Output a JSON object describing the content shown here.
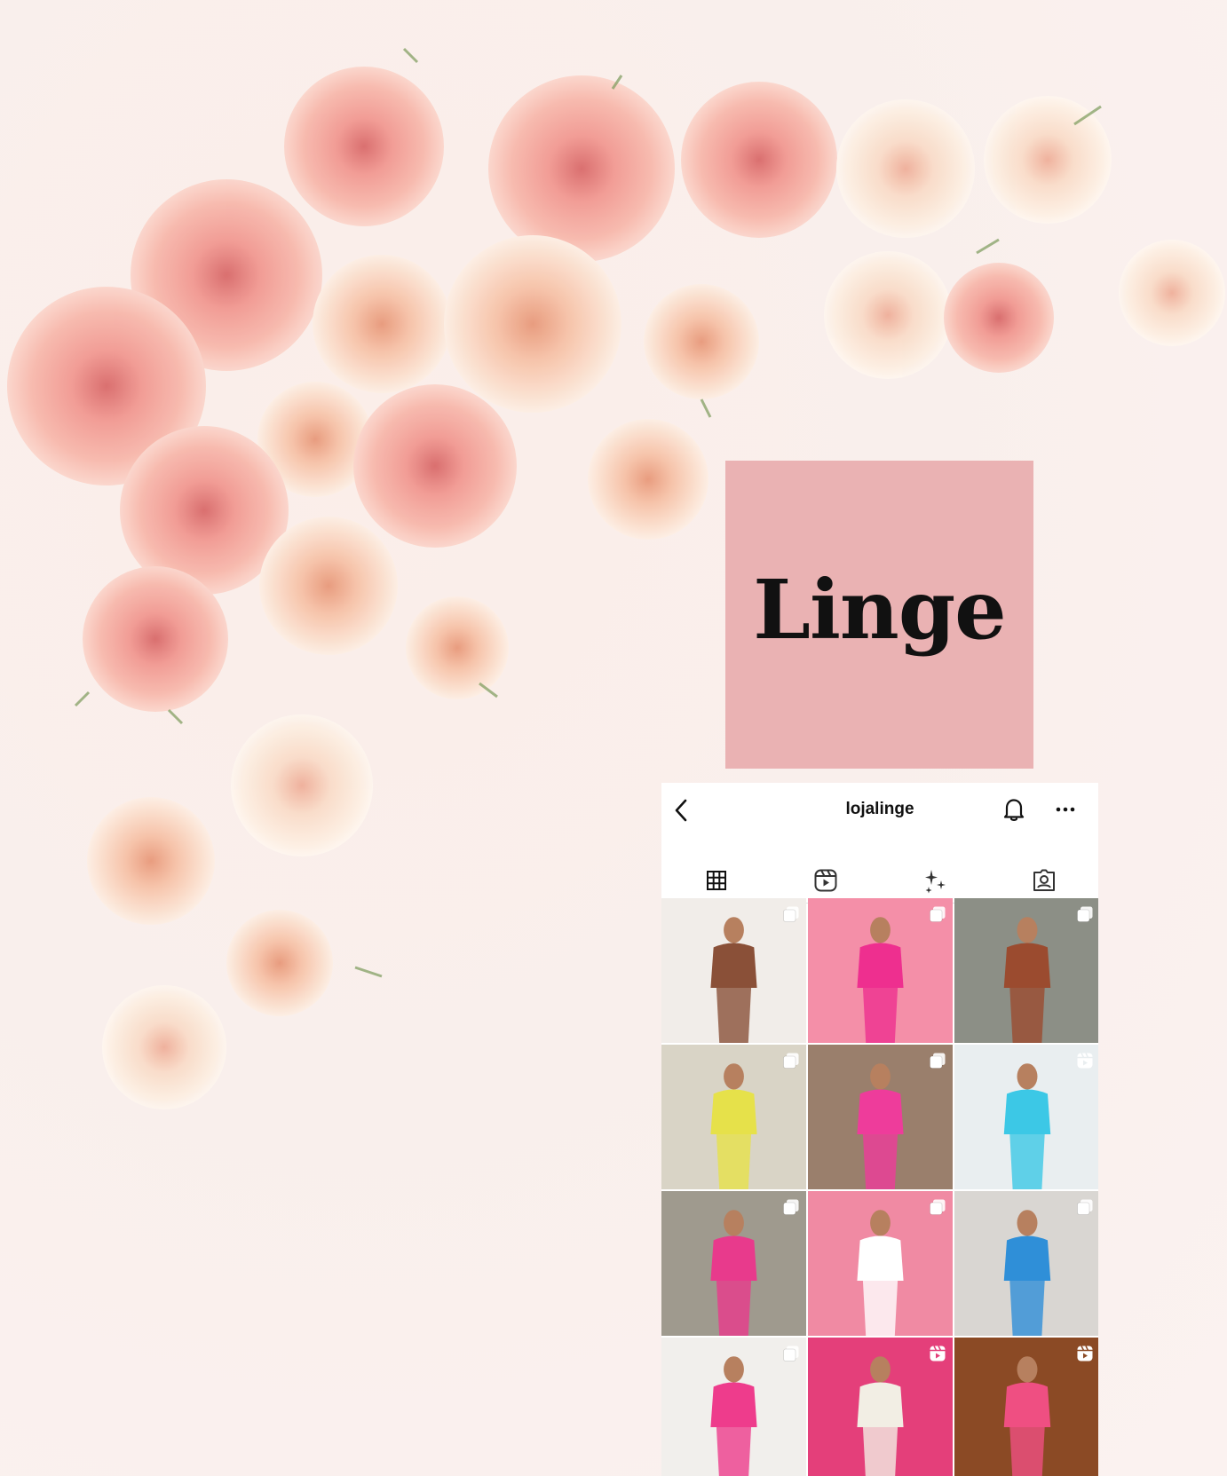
{
  "brand": {
    "logo_text": "Linge",
    "logo_bg": "#eab2b3"
  },
  "profile": {
    "username": "lojalinge",
    "icons": {
      "back": "chevron-left-icon",
      "notifications": "bell-icon",
      "more": "more-horizontal-icon"
    }
  },
  "tabs": [
    {
      "name": "posts",
      "icon": "grid-icon",
      "active": true
    },
    {
      "name": "reels",
      "icon": "reels-icon",
      "active": false
    },
    {
      "name": "effects",
      "icon": "sparkles-icon",
      "active": false
    },
    {
      "name": "tagged",
      "icon": "tagged-person-icon",
      "active": false
    }
  ],
  "posts": [
    {
      "type": "carousel",
      "bg": "#f1ede9",
      "accent": "#8a5038"
    },
    {
      "type": "carousel",
      "bg": "#f48fa8",
      "accent": "#ee2f8f"
    },
    {
      "type": "carousel",
      "bg": "#8c8f86",
      "accent": "#9b4b2f"
    },
    {
      "type": "carousel",
      "bg": "#d9d4c6",
      "accent": "#e6e14a"
    },
    {
      "type": "carousel",
      "bg": "#9a7f6c",
      "accent": "#ee3c9b"
    },
    {
      "type": "reel",
      "bg": "#e9eef0",
      "accent": "#3cc8e6"
    },
    {
      "type": "carousel",
      "bg": "#9f9a8e",
      "accent": "#e83a8c"
    },
    {
      "type": "carousel",
      "bg": "#f08aa3",
      "accent": "#ffffff"
    },
    {
      "type": "carousel",
      "bg": "#d9d6d2",
      "accent": "#2f8fd8"
    },
    {
      "type": "carousel",
      "bg": "#f1efec",
      "accent": "#ee3c8c"
    },
    {
      "type": "reel",
      "bg": "#e43f7a",
      "accent": "#f2eee4"
    },
    {
      "type": "reel",
      "bg": "#8b4a25",
      "accent": "#ef4f82"
    }
  ]
}
